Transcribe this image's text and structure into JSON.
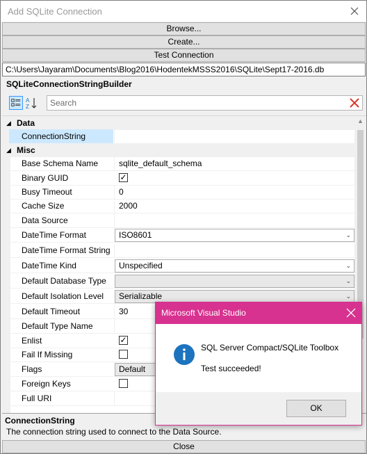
{
  "window": {
    "title": "Add SQLite Connection"
  },
  "buttons": {
    "browse": "Browse...",
    "create": "Create...",
    "test": "Test Connection",
    "close": "Close"
  },
  "path": "C:\\Users\\Jayaram\\Documents\\Blog2016\\HodentekMSSS2016\\SQLite\\Sept17-2016.db",
  "property_grid": {
    "title": "SQLiteConnectionStringBuilder",
    "search_placeholder": "Search",
    "categories": [
      {
        "label": "Data",
        "expander": "◢"
      },
      {
        "label": "Misc",
        "expander": "◢"
      }
    ],
    "rows": [
      {
        "name": "ConnectionString",
        "value": ""
      },
      {
        "name": "Base Schema Name",
        "value": "sqlite_default_schema"
      },
      {
        "name": "Binary GUID",
        "value": ""
      },
      {
        "name": "Busy Timeout",
        "value": "0"
      },
      {
        "name": "Cache Size",
        "value": "2000"
      },
      {
        "name": "Data Source",
        "value": ""
      },
      {
        "name": "DateTime Format",
        "value": "ISO8601"
      },
      {
        "name": "DateTime Format String",
        "value": ""
      },
      {
        "name": "DateTime Kind",
        "value": "Unspecified"
      },
      {
        "name": "Default Database Type",
        "value": ""
      },
      {
        "name": "Default Isolation Level",
        "value": "Serializable"
      },
      {
        "name": "Default Timeout",
        "value": "30"
      },
      {
        "name": "Default Type Name",
        "value": ""
      },
      {
        "name": "Enlist",
        "value": ""
      },
      {
        "name": "Fail If Missing",
        "value": ""
      },
      {
        "name": "Flags",
        "value": "Default"
      },
      {
        "name": "Foreign Keys",
        "value": ""
      },
      {
        "name": "Full URI",
        "value": ""
      }
    ],
    "checks": {
      "binary_guid": "✓",
      "enlist": "✓"
    },
    "dropdown_arrow": "⌄"
  },
  "description": {
    "title": "ConnectionString",
    "text": "The connection string used to connect to the Data Source."
  },
  "message_box": {
    "title": "Microsoft Visual Studio",
    "line1": "SQL Server Compact/SQLite Toolbox",
    "line2": "Test succeeded!",
    "ok": "OK",
    "accent": "#d7328f"
  },
  "colors": {
    "selection": "#cce8ff",
    "info_icon": "#1e73be"
  }
}
